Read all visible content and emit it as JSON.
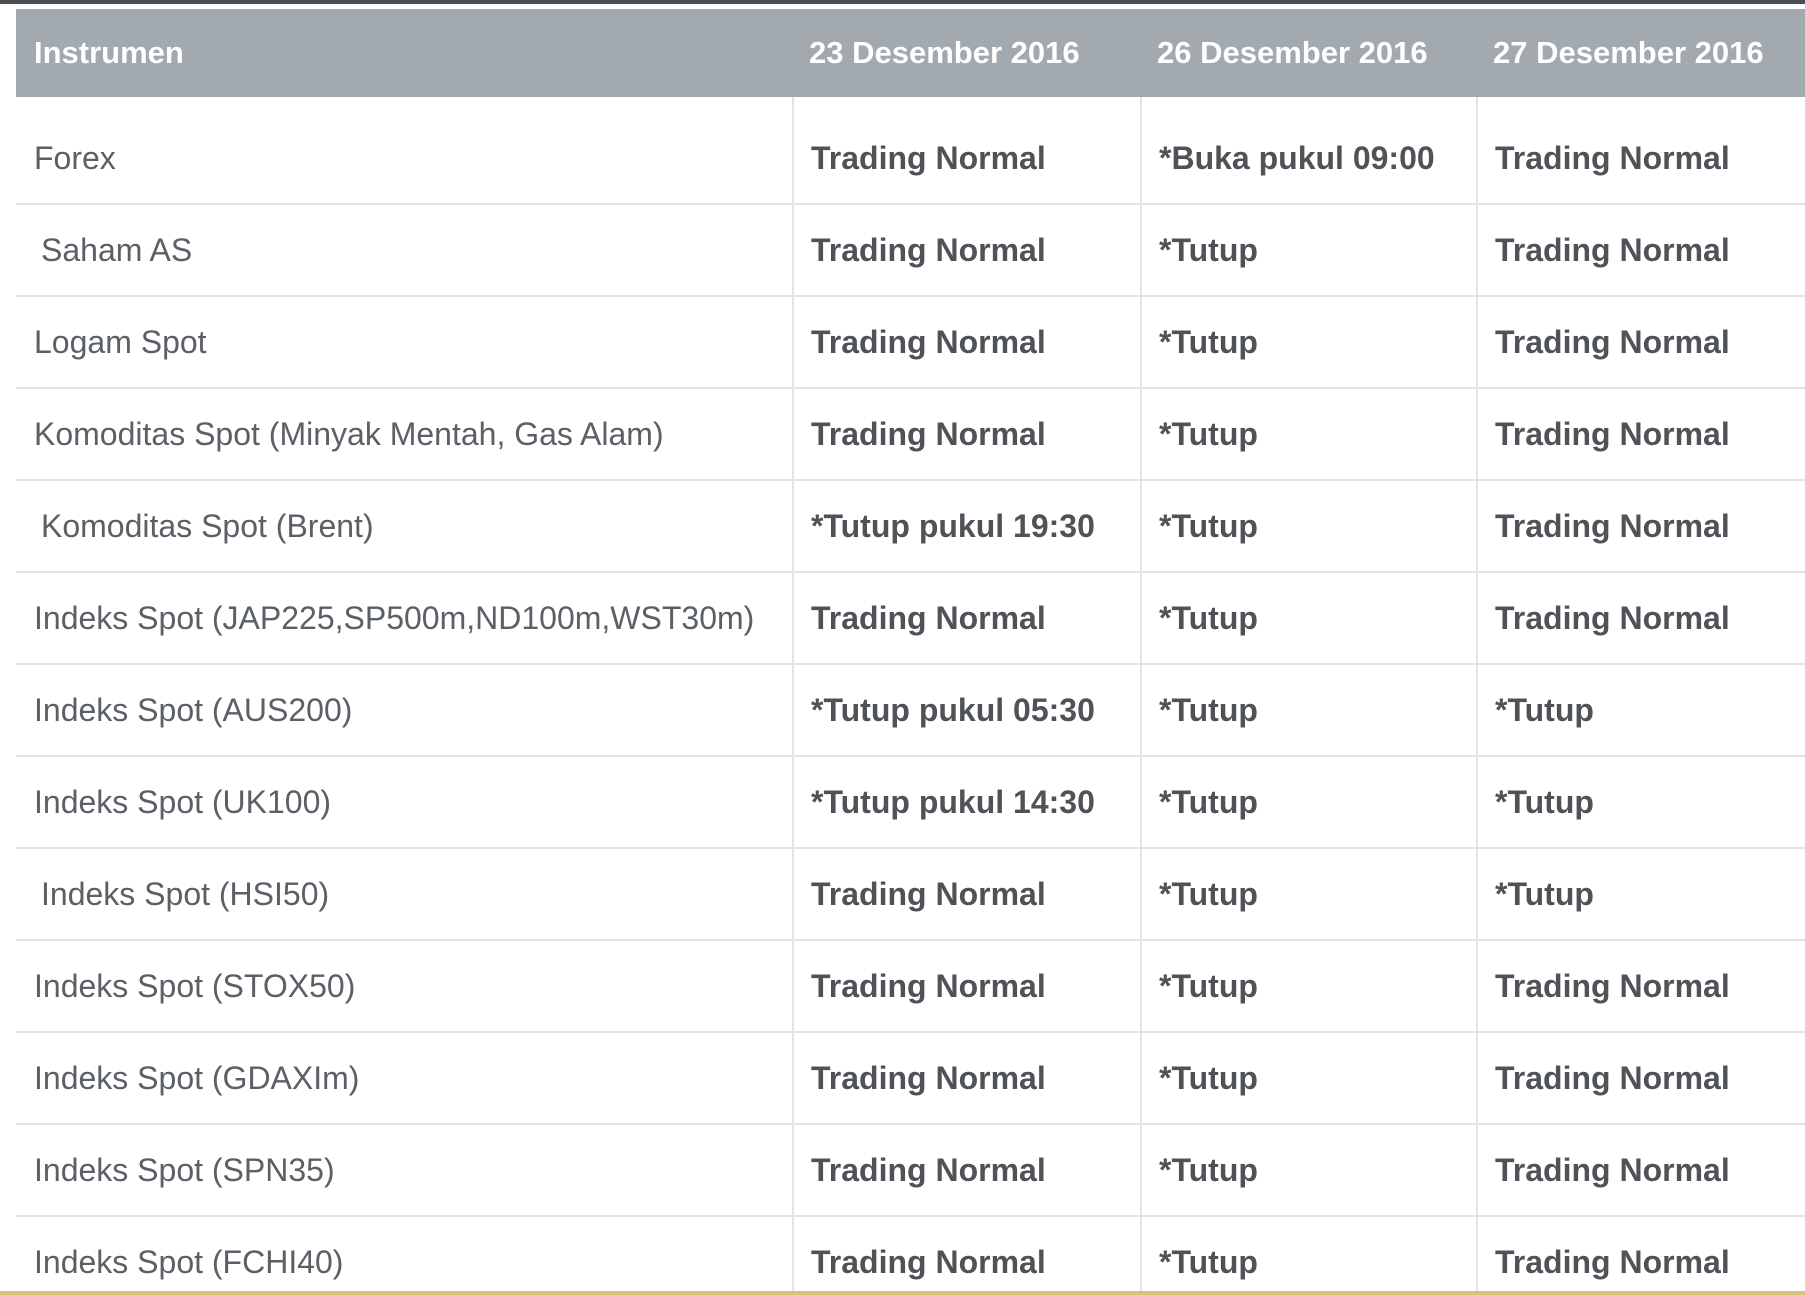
{
  "table": {
    "headers": [
      "Instrumen",
      "23 Desember 2016",
      "26 Desember 2016",
      "27 Desember 2016"
    ],
    "rows": [
      {
        "instrument": "Forex",
        "d1": "Trading Normal",
        "d2": "*Buka pukul 09:00",
        "d3": "Trading Normal"
      },
      {
        "instrument": "Saham AS",
        "d1": "Trading Normal",
        "d2": "*Tutup",
        "d3": "Trading Normal"
      },
      {
        "instrument": "Logam Spot",
        "d1": "Trading Normal",
        "d2": "*Tutup",
        "d3": "Trading Normal"
      },
      {
        "instrument": "Komoditas Spot (Minyak Mentah, Gas Alam)",
        "d1": "Trading Normal",
        "d2": "*Tutup",
        "d3": "Trading Normal"
      },
      {
        "instrument": "Komoditas Spot (Brent)",
        "d1": "*Tutup pukul 19:30",
        "d2": "*Tutup",
        "d3": "Trading Normal"
      },
      {
        "instrument": "Indeks Spot (JAP225,SP500m,ND100m,WST30m)",
        "d1": "Trading Normal",
        "d2": "*Tutup",
        "d3": "Trading Normal"
      },
      {
        "instrument": "Indeks Spot (AUS200)",
        "d1": "*Tutup pukul 05:30",
        "d2": "*Tutup",
        "d3": "*Tutup"
      },
      {
        "instrument": "Indeks Spot (UK100)",
        "d1": "*Tutup pukul 14:30",
        "d2": "*Tutup",
        "d3": "*Tutup"
      },
      {
        "instrument": "Indeks Spot (HSI50)",
        "d1": "Trading Normal",
        "d2": "*Tutup",
        "d3": "*Tutup"
      },
      {
        "instrument": "Indeks Spot (STOX50)",
        "d1": "Trading Normal",
        "d2": "*Tutup",
        "d3": "Trading Normal"
      },
      {
        "instrument": "Indeks Spot (GDAXIm)",
        "d1": "Trading Normal",
        "d2": "*Tutup",
        "d3": "Trading Normal"
      },
      {
        "instrument": "Indeks Spot (SPN35)",
        "d1": "Trading Normal",
        "d2": "*Tutup",
        "d3": "Trading Normal"
      },
      {
        "instrument": "Indeks Spot (FCHI40)",
        "d1": "Trading Normal",
        "d2": "*Tutup",
        "d3": "Trading Normal"
      }
    ]
  }
}
